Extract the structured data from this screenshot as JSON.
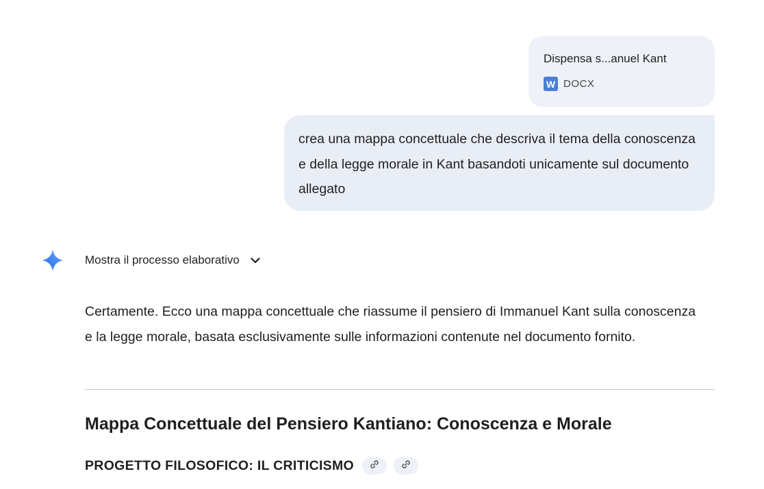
{
  "attachment": {
    "file_name": "Dispensa s...anuel Kant",
    "icon_letter": "W",
    "file_type": "DOCX",
    "icon": "word-doc-icon",
    "icon_color": "#4a7fd6"
  },
  "user_prompt": {
    "text": "crea una mappa concettuale che descriva il tema della conoscenza e della legge morale in Kant basandoti unicamente sul documento allegato"
  },
  "response": {
    "icon": "gemini-sparkle-icon",
    "thoughts_toggle_label": "Mostra il processo elaborativo",
    "intro_text": "Certamente. Ecco una mappa concettuale che riassume il pensiero di Immanuel Kant sulla conoscenza e la legge morale, basata esclusivamente sulle informazioni contenute nel documento fornito.",
    "heading": "Mappa Concettuale del Pensiero Kantiano: Conoscenza e Morale",
    "subheading": "PROGETTO FILOSOFICO: IL CRITICISMO",
    "source_links": [
      {
        "icon": "link-icon"
      },
      {
        "icon": "link-icon"
      }
    ]
  },
  "colors": {
    "user_bubble_bg": "#e9eef6",
    "file_bubble_bg": "#eef1f7",
    "text": "#1f1f1f",
    "divider": "#c7c7c7"
  }
}
